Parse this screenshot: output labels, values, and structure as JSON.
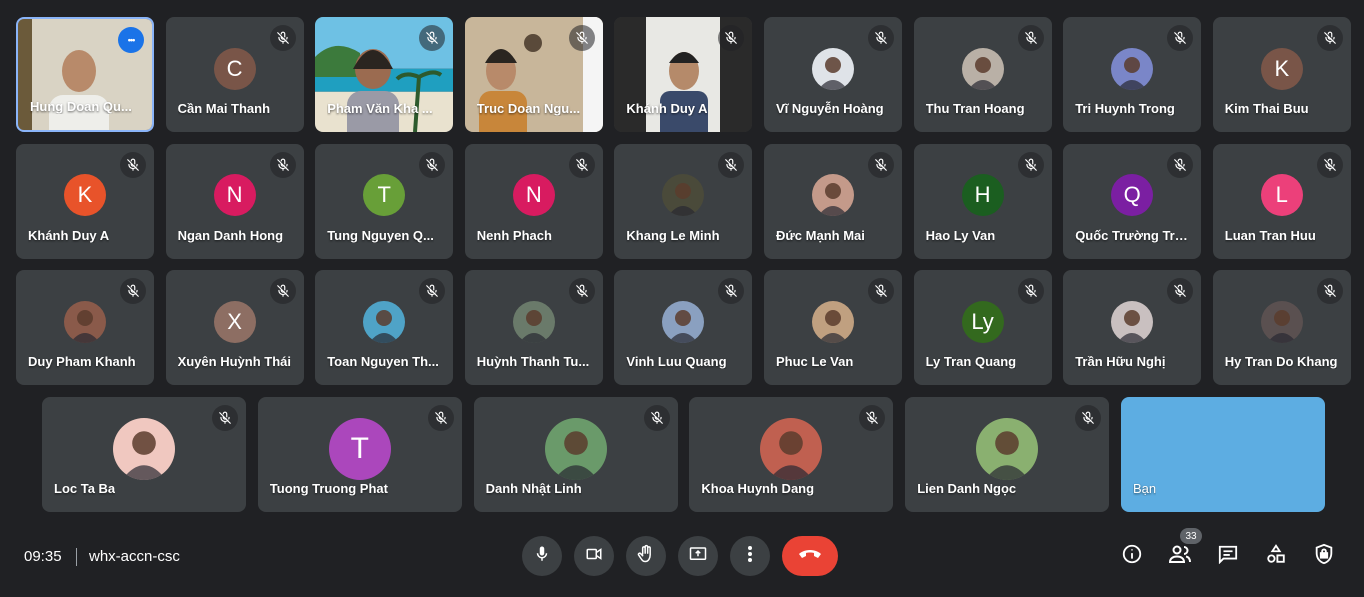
{
  "participants": [
    {
      "name": "Hung Doan Qu...",
      "initial": "",
      "color": "",
      "kind": "video",
      "active": true,
      "more": true
    },
    {
      "name": "Cần Mai Thanh",
      "initial": "C",
      "color": "#795548",
      "kind": "letter"
    },
    {
      "name": "Pham Văn Kha ...",
      "initial": "",
      "color": "",
      "kind": "video"
    },
    {
      "name": "Truc Doan Ngu...",
      "initial": "",
      "color": "",
      "kind": "video"
    },
    {
      "name": "Khánh Duy A",
      "initial": "",
      "color": "",
      "kind": "video"
    },
    {
      "name": "Vĩ Nguyễn Hoàng",
      "initial": "",
      "color": "#dfe3e8",
      "kind": "photo"
    },
    {
      "name": "Thu Tran Hoang",
      "initial": "",
      "color": "#b9b0a6",
      "kind": "photo"
    },
    {
      "name": "Tri Huynh Trong",
      "initial": "",
      "color": "#7a86c8",
      "kind": "photo"
    },
    {
      "name": "Kim Thai Buu",
      "initial": "K",
      "color": "#795548",
      "kind": "letter"
    },
    {
      "name": "Khánh Duy A",
      "initial": "K",
      "color": "#e8532a",
      "kind": "letter"
    },
    {
      "name": "Ngan Danh Hong",
      "initial": "N",
      "color": "#d81b60",
      "kind": "letter"
    },
    {
      "name": "Tung Nguyen Q...",
      "initial": "T",
      "color": "#689f38",
      "kind": "letter"
    },
    {
      "name": "Nenh Phach",
      "initial": "N",
      "color": "#d81b60",
      "kind": "letter"
    },
    {
      "name": "Khang Le Minh",
      "initial": "",
      "color": "#4a4a3a",
      "kind": "photo"
    },
    {
      "name": "Đức Mạnh Mai",
      "initial": "",
      "color": "#c49a8a",
      "kind": "photo"
    },
    {
      "name": "Hao Ly Van",
      "initial": "H",
      "color": "#1b5e20",
      "kind": "letter"
    },
    {
      "name": "Quốc Trường Trần",
      "initial": "Q",
      "color": "#7b1fa2",
      "kind": "letter"
    },
    {
      "name": "Luan Tran Huu",
      "initial": "L",
      "color": "#ec407a",
      "kind": "letter"
    },
    {
      "name": "Duy Pham Khanh",
      "initial": "",
      "color": "#8a5a4a",
      "kind": "photo"
    },
    {
      "name": "Xuyên Huỳnh Thái",
      "initial": "X",
      "color": "#8d6e63",
      "kind": "letter"
    },
    {
      "name": "Toan Nguyen Th...",
      "initial": "",
      "color": "#4fa3c7",
      "kind": "photo"
    },
    {
      "name": "Huỳnh Thanh Tu...",
      "initial": "",
      "color": "#6a7a6a",
      "kind": "photo"
    },
    {
      "name": "Vinh Luu Quang",
      "initial": "",
      "color": "#8aa0c0",
      "kind": "photo"
    },
    {
      "name": "Phuc Le Van",
      "initial": "",
      "color": "#c0a080",
      "kind": "photo"
    },
    {
      "name": "Ly Tran Quang",
      "initial": "Ly",
      "color": "#33691e",
      "kind": "letter"
    },
    {
      "name": "Trần Hữu Nghị",
      "initial": "",
      "color": "#c9c0c0",
      "kind": "photo"
    },
    {
      "name": "Hy Tran Do Khang",
      "initial": "",
      "color": "#5a5050",
      "kind": "photo"
    },
    {
      "name": "Loc Ta Ba",
      "initial": "",
      "color": "#f0c8c0",
      "kind": "photo"
    },
    {
      "name": "Tuong Truong Phat",
      "initial": "T",
      "color": "#ab47bc",
      "kind": "letter"
    },
    {
      "name": "Danh Nhật Linh",
      "initial": "",
      "color": "#6a9a6a",
      "kind": "photo"
    },
    {
      "name": "Khoa Huynh Dang",
      "initial": "",
      "color": "#c06050",
      "kind": "photo"
    },
    {
      "name": "Lien Danh Ngọc",
      "initial": "",
      "color": "#8ab070",
      "kind": "photo"
    },
    {
      "name": "Bạn",
      "initial": "",
      "color": "",
      "kind": "self"
    }
  ],
  "meeting": {
    "time": "09:35",
    "code": "whx-accn-csc"
  },
  "people_count": "33",
  "colors": {
    "background": "#202124",
    "tile": "#3c4043",
    "hangup": "#ea4335",
    "self_tile": "#5dade2"
  }
}
